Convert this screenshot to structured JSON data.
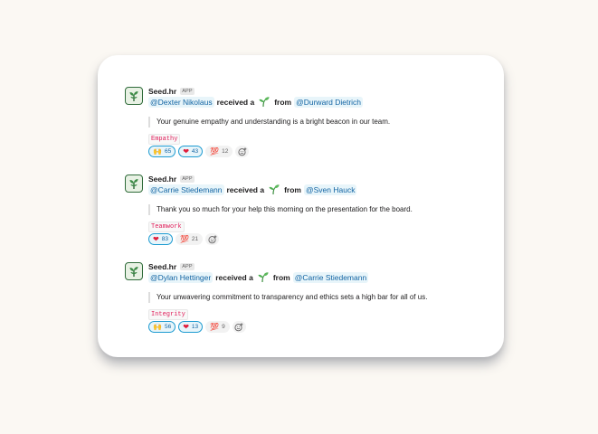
{
  "messages": [
    {
      "app_name": "Seed.hr",
      "app_badge": "APP",
      "recipient": "@Dexter Nikolaus",
      "received_text": "received a",
      "from_text": "from",
      "sender": "@Durward Dietrich",
      "quote": "Your genuine empathy and understanding is a bright beacon in our team.",
      "tag": "Empathy",
      "reactions": [
        {
          "emoji": "🙌",
          "icon": "raised-hands-icon",
          "count": "65",
          "active": true
        },
        {
          "emoji": "❤",
          "icon": "heart-icon",
          "count": "43",
          "active": true
        },
        {
          "emoji": "💯",
          "icon": "hundred-icon",
          "count": "12",
          "active": false
        }
      ]
    },
    {
      "app_name": "Seed.hr",
      "app_badge": "APP",
      "recipient": "@Carrie Stiedemann",
      "received_text": "received a",
      "from_text": "from",
      "sender": "@Sven Hauck",
      "quote": "Thank you so much for your help this morning on the presentation for the board.",
      "tag": "Teamwork",
      "reactions": [
        {
          "emoji": "❤",
          "icon": "heart-icon",
          "count": "83",
          "active": true
        },
        {
          "emoji": "💯",
          "icon": "hundred-icon",
          "count": "21",
          "active": false
        }
      ]
    },
    {
      "app_name": "Seed.hr",
      "app_badge": "APP",
      "recipient": "@Dylan Hettinger",
      "received_text": "received a",
      "from_text": "from",
      "sender": "@Carrie Stiedemann",
      "quote": "Your unwavering commitment to transparency and ethics sets a high bar for all of us.",
      "tag": "Integrity",
      "reactions": [
        {
          "emoji": "🙌",
          "icon": "raised-hands-icon",
          "count": "56",
          "active": true
        },
        {
          "emoji": "❤",
          "icon": "heart-icon",
          "count": "13",
          "active": true
        },
        {
          "emoji": "💯",
          "icon": "hundred-icon",
          "count": "9",
          "active": false
        }
      ]
    }
  ],
  "colors": {
    "background": "#fbf8f3",
    "mention_text": "#1264a3",
    "mention_bg": "#e8f5fa",
    "tag_text": "#e01e5a",
    "active_reaction_border": "#1d9bd1",
    "heart": "#e01e3c",
    "hundred": "#dd2e44",
    "sprout_green": "#4caf50"
  }
}
